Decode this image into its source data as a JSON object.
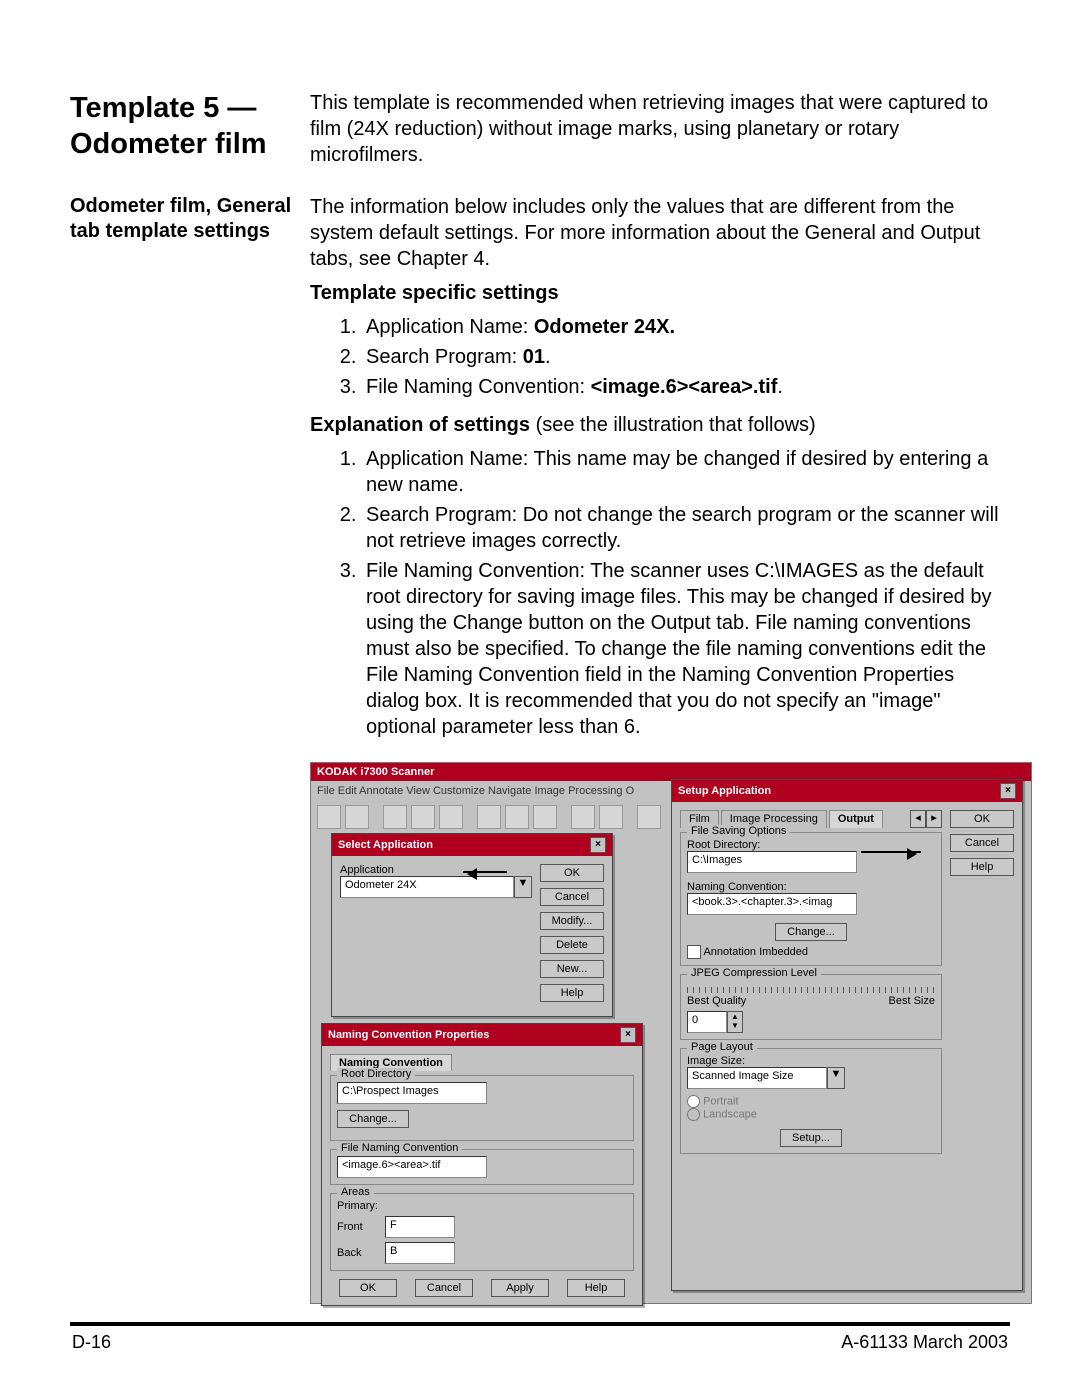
{
  "heading": "Template 5 — Odometer film",
  "intro": "This template is recommended when retrieving images that were captured to film (24X reduction) without image marks, using planetary or rotary microfilmers.",
  "subhead": "Odometer film, General tab template settings",
  "sub_intro": "The information below includes only the values that are different from the system default settings.  For more information about the General and Output tabs, see Chapter 4.",
  "tss_label": "Template specific settings",
  "tss": {
    "p1a": "Application Name: ",
    "p1b": "Odometer 24X.",
    "p2a": "Search Program: ",
    "p2b": "01",
    "p3a": "File Naming Convention: ",
    "p3b": "<image.6><area>.tif"
  },
  "exp_label": "Explanation of settings",
  "exp_trail": " (see the illustration that follows)",
  "exp": {
    "e1": "Application Name: This name may be changed if desired by entering a new name.",
    "e2": "Search Program: Do not change the search program or the scanner will not retrieve images correctly.",
    "e3": "File Naming Convention: The scanner uses C:\\IMAGES as the default root directory for saving image files. This may be changed if desired by using the Change button on the Output tab. File naming conventions must also be specified. To change the file naming conventions edit the File Naming Convention field in the Naming Convention Properties dialog box. It is recommended that you do not specify an \"image\" optional parameter less than 6."
  },
  "screenshot": {
    "main_title": "KODAK i7300 Scanner",
    "menu": "File   Edit   Annotate   View   Customize   Navigate   Image Processing   O",
    "select_app": {
      "title": "Select Application",
      "label": "Application",
      "value": "Odometer 24X",
      "buttons": {
        "ok": "OK",
        "cancel": "Cancel",
        "modify": "Modify...",
        "delete": "Delete",
        "new": "New...",
        "help": "Help"
      }
    },
    "naming": {
      "title": "Naming Convention Properties",
      "tab": "Naming Convention",
      "root_legend": "Root Directory",
      "root_value": "C:\\Prospect Images",
      "change": "Change...",
      "fnc_legend": "File Naming Convention",
      "fnc_value": "<image.6><area>.tif",
      "areas_legend": "Areas",
      "primary": "Primary:",
      "front": "Front",
      "front_v": "F",
      "back": "Back",
      "back_v": "B",
      "btn_ok": "OK",
      "btn_cancel": "Cancel",
      "btn_apply": "Apply",
      "btn_help": "Help"
    },
    "setup": {
      "title": "Setup Application",
      "tabs": {
        "film": "Film",
        "img": "Image Processing",
        "out": "Output"
      },
      "fso_legend": "File Saving Options",
      "root_label": "Root Directory:",
      "root_value": "C:\\Images",
      "nc_label": "Naming Convention:",
      "nc_value": "<book.3>.<chapter.3>.<imag",
      "change": "Change...",
      "annot": "Annotation Imbedded",
      "jpeg_legend": "JPEG Compression Level",
      "jpeg_left": "Best Quality",
      "jpeg_right": "Best Size",
      "jpeg_val": "0",
      "pl_legend": "Page Layout",
      "imgsize_label": "Image Size:",
      "imgsize_value": "Scanned Image Size",
      "portrait": "Portrait",
      "landscape": "Landscape",
      "setup_btn": "Setup...",
      "btn_ok": "OK",
      "btn_cancel": "Cancel",
      "btn_help": "Help"
    }
  },
  "footer": {
    "left": "D-16",
    "right": "A-61133  March 2003"
  }
}
